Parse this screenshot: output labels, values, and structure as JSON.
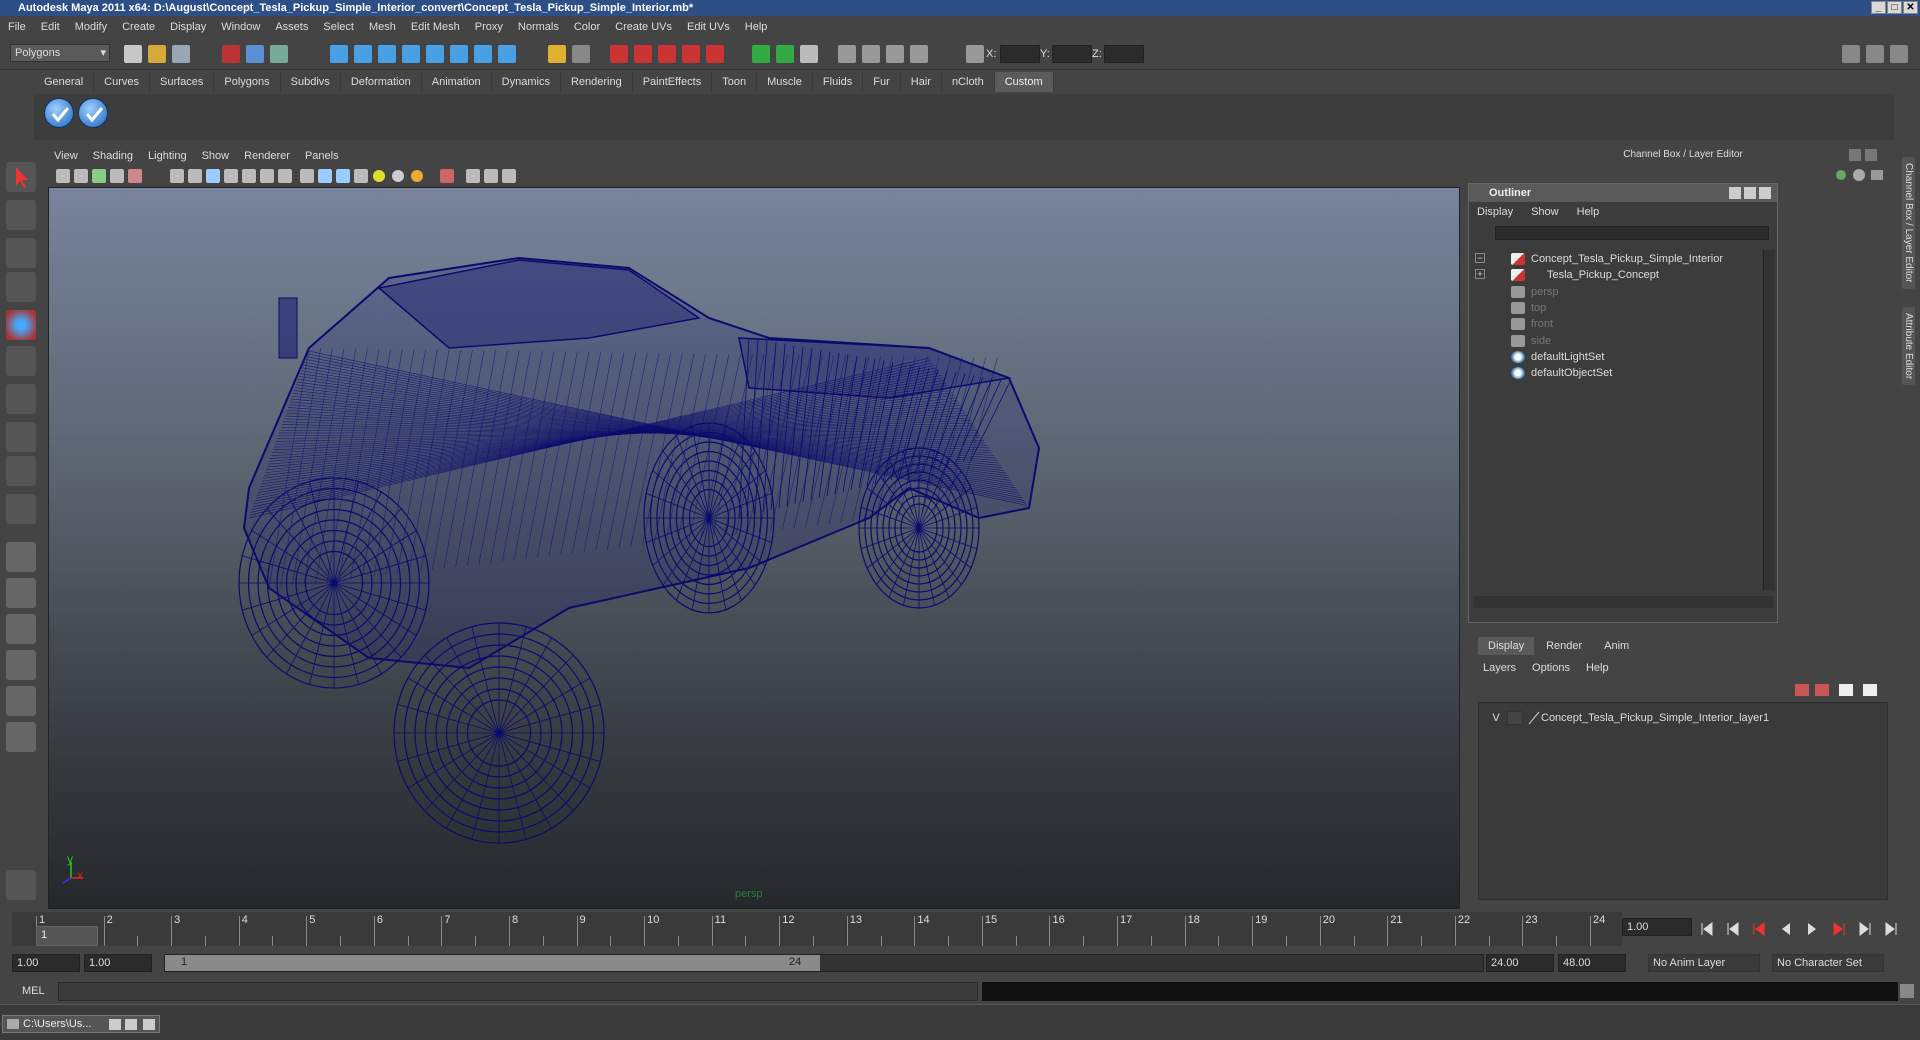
{
  "window": {
    "title": "Autodesk Maya 2011 x64: D:\\August\\Concept_Tesla_Pickup_Simple_Interior_convert\\Concept_Tesla_Pickup_Simple_Interior.mb*",
    "min": "_",
    "max": "□",
    "close": "✕"
  },
  "menus": [
    "File",
    "Edit",
    "Modify",
    "Create",
    "Display",
    "Window",
    "Assets",
    "Select",
    "Mesh",
    "Edit Mesh",
    "Proxy",
    "Normals",
    "Color",
    "Create UVs",
    "Edit UVs",
    "Help"
  ],
  "status": {
    "mode": "Polygons",
    "x_label": "X:",
    "y_label": "Y:",
    "z_label": "Z:"
  },
  "shelf": {
    "tabs": [
      "General",
      "Curves",
      "Surfaces",
      "Polygons",
      "Subdivs",
      "Deformation",
      "Animation",
      "Dynamics",
      "Rendering",
      "PaintEffects",
      "Toon",
      "Muscle",
      "Fluids",
      "Fur",
      "Hair",
      "nCloth",
      "Custom"
    ],
    "active": "Custom",
    "icons": [
      "check-icon",
      "check-icon"
    ]
  },
  "viewport": {
    "menus": [
      "View",
      "Shading",
      "Lighting",
      "Show",
      "Renderer",
      "Panels"
    ],
    "camera": "persp",
    "axis_y": "y",
    "axis_x": "x",
    "wire_color": "#0b0b6e",
    "bg_top": "#78849c",
    "bg_bottom": "#25282b"
  },
  "channel_box": {
    "header": "Channel Box / Layer Editor"
  },
  "outliner": {
    "title": "Outliner",
    "menus": [
      "Display",
      "Show",
      "Help"
    ],
    "items": [
      {
        "label": "Concept_Tesla_Pickup_Simple_Interior",
        "dim": false,
        "icon": "transform-icon",
        "expander": "−"
      },
      {
        "label": "Tesla_Pickup_Concept",
        "dim": false,
        "icon": "transform-icon",
        "expander": "+"
      },
      {
        "label": "persp",
        "dim": true,
        "icon": "camera-icon",
        "expander": ""
      },
      {
        "label": "top",
        "dim": true,
        "icon": "camera-icon",
        "expander": ""
      },
      {
        "label": "front",
        "dim": true,
        "icon": "camera-icon",
        "expander": ""
      },
      {
        "label": "side",
        "dim": true,
        "icon": "camera-icon",
        "expander": ""
      },
      {
        "label": "defaultLightSet",
        "dim": false,
        "icon": "set-icon",
        "expander": ""
      },
      {
        "label": "defaultObjectSet",
        "dim": false,
        "icon": "set-icon",
        "expander": ""
      }
    ]
  },
  "layer_editor": {
    "tabs": [
      "Display",
      "Render",
      "Anim"
    ],
    "active": "Display",
    "menus": [
      "Layers",
      "Options",
      "Help"
    ],
    "layers": [
      {
        "visible": "V",
        "name": "Concept_Tesla_Pickup_Simple_Interior_layer1"
      }
    ]
  },
  "side_tabs": [
    "Channel Box / Layer Editor",
    "Attribute Editor"
  ],
  "timeline": {
    "frames": [
      "1",
      "2",
      "3",
      "4",
      "5",
      "6",
      "7",
      "8",
      "9",
      "10",
      "11",
      "12",
      "13",
      "14",
      "15",
      "16",
      "17",
      "18",
      "19",
      "20",
      "21",
      "22",
      "23",
      "24"
    ],
    "current_frame_marker": "1",
    "current_time": "1.00"
  },
  "range": {
    "start": "1.00",
    "anim_start": "1.00",
    "slider_start": "1",
    "slider_end": "24",
    "anim_end": "24.00",
    "end": "48.00",
    "anim_layer": "No Anim Layer",
    "char_set": "No Character Set"
  },
  "cmdline": {
    "label": "MEL"
  },
  "taskbar": {
    "item": "C:\\Users\\Us..."
  }
}
